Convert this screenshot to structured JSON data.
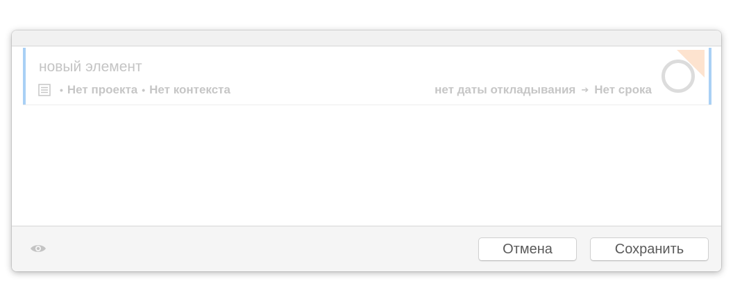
{
  "item": {
    "title": "новый элемент",
    "project": "Нет проекта",
    "context": "Нет контекста",
    "separator": "•",
    "defer_date": "нет даты откладывания",
    "arrow": "➔",
    "due": "Нет срока"
  },
  "icons": {
    "note": "note-icon",
    "flag": "flag-corner-icon",
    "status": "status-circle-icon",
    "eye": "eye-icon"
  },
  "footer": {
    "cancel_label": "Отмена",
    "save_label": "Сохранить"
  },
  "colors": {
    "accent_bar": "#a9d0f5",
    "flag": "#fde3cf",
    "muted_text": "#c6c6c6"
  }
}
